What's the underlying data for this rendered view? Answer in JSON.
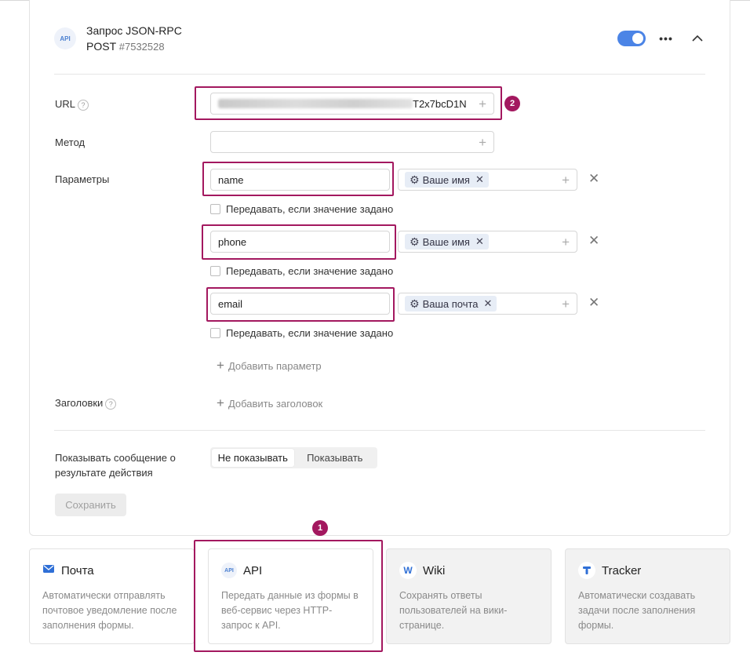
{
  "header": {
    "api_badge": "API",
    "title": "Запрос JSON-RPC",
    "method": "POST",
    "id": "#7532528",
    "toggle_on": true
  },
  "fields": {
    "url_label": "URL",
    "url_value_visible": "T2x7bcD1N",
    "method_label": "Метод",
    "method_value": "",
    "params_label": "Параметры",
    "headers_label": "Заголовки",
    "help_glyph": "?"
  },
  "params": [
    {
      "name": "name",
      "chip": "Ваше имя",
      "pass_if_set": "Передавать, если значение задано"
    },
    {
      "name": "phone",
      "chip": "Ваше имя",
      "pass_if_set": "Передавать, если значение задано"
    },
    {
      "name": "email",
      "chip": "Ваша почта",
      "pass_if_set": "Передавать, если значение задано"
    }
  ],
  "actions": {
    "add_param": "Добавить параметр",
    "add_header": "Добавить заголовок",
    "save": "Сохранить"
  },
  "result_message": {
    "label": "Показывать сообщение о результате действия",
    "options": [
      "Не показывать",
      "Показывать"
    ],
    "selected": "Не показывать"
  },
  "markers": {
    "m1": "1",
    "m2": "2"
  },
  "integrations": [
    {
      "icon": "mail-icon",
      "title": "Почта",
      "desc": "Автоматически отправлять почтовое уведомление после заполнения формы.",
      "color": "#2f6fd6"
    },
    {
      "icon": "api-icon",
      "glyph": "API",
      "title": "API",
      "desc": "Передать данные из формы в веб-сервис через HTTP-запрос к API.",
      "color": "#4a7fd0"
    },
    {
      "icon": "wiki-icon",
      "glyph": "W",
      "title": "Wiki",
      "desc": "Сохранять ответы пользователей на вики-странице.",
      "color": "#2f6fd6"
    },
    {
      "icon": "tracker-icon",
      "title": "Tracker",
      "desc": "Автоматически создавать задачи после заполнения формы.",
      "color": "#2f6fd6"
    }
  ],
  "colors": {
    "accent": "#4b84e6",
    "highlight": "#a3185f"
  }
}
